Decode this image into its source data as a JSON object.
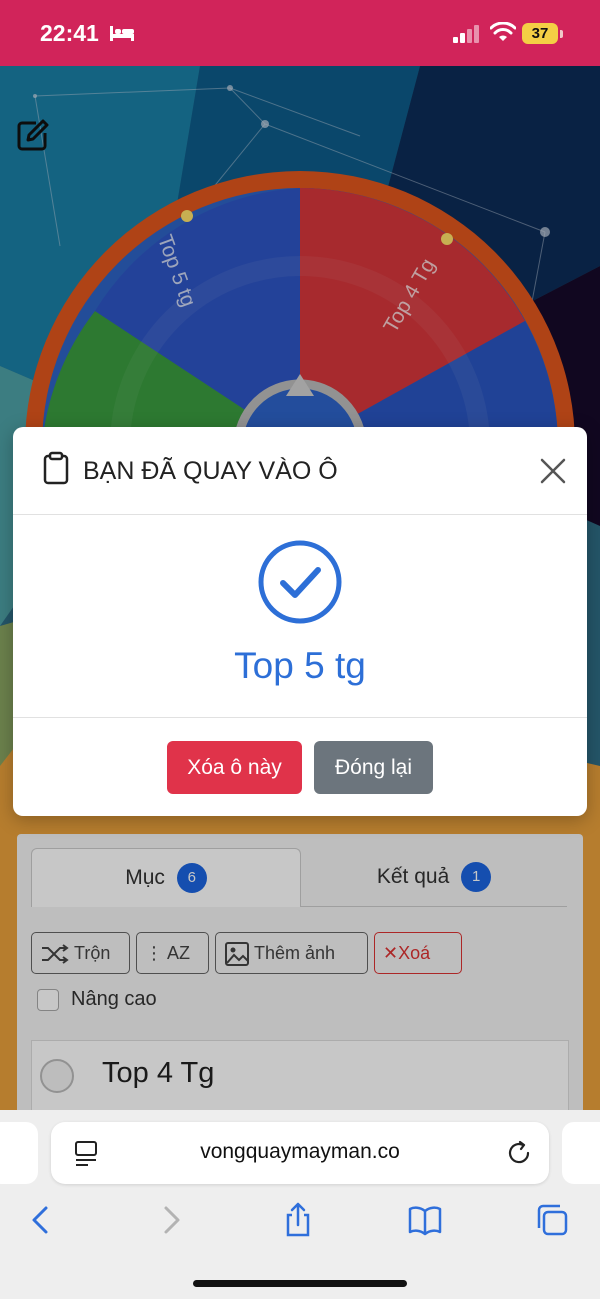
{
  "status_bar": {
    "time": "22:41",
    "battery": "37",
    "background_color": "#d1245a"
  },
  "wheel": {
    "segment_labels": [
      "Top 5 tg",
      "Top 4 Tg"
    ]
  },
  "modal": {
    "title": "BẠN ĐÃ QUAY VÀO Ô",
    "result": "Top 5 tg",
    "delete_button": "Xóa ô này",
    "close_button": "Đóng lại",
    "accent_color": "#2d6fd7"
  },
  "panel": {
    "tabs": [
      {
        "label": "Mục",
        "count": "6"
      },
      {
        "label": "Kết quả",
        "count": "1"
      }
    ],
    "tools": {
      "shuffle": "Trộn",
      "sort": "AZ",
      "add_image": "Thêm ảnh",
      "clear": "Xoá"
    },
    "advanced_label": "Nâng cao",
    "items": [
      "Top 4 Tg"
    ]
  },
  "browser": {
    "url": "vongquaymayman.co"
  }
}
